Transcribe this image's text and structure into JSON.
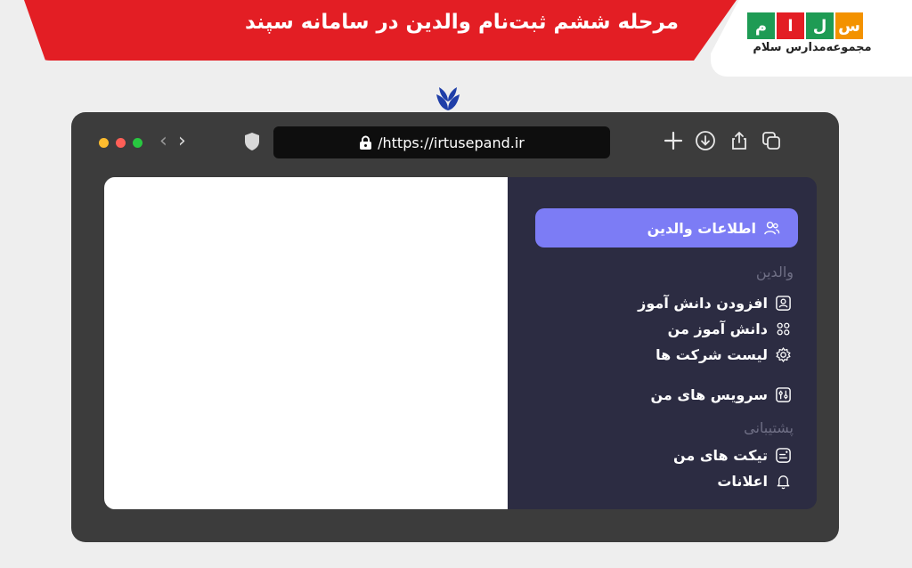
{
  "banner": {
    "title": "مرحله ششم ثبت‌نام والدین در سامانه سپند"
  },
  "logo": {
    "letters": [
      "م",
      "ا",
      "ل",
      "س"
    ],
    "subtitle": "مجموعه‌مدارس سلام"
  },
  "browser": {
    "url": "/https://irtusepand.ir"
  },
  "sidebar": {
    "active_item": {
      "label": "اطلاعات والدین",
      "icon": "users-icon"
    },
    "sections": [
      {
        "label": "والدین"
      },
      {
        "label": "پشتیبانی"
      }
    ],
    "items": [
      {
        "label": "افزودن دانش آموز",
        "icon": "user-badge-icon"
      },
      {
        "label": "دانش آموز من",
        "icon": "group-icon"
      },
      {
        "label": "لیست شرکت ها",
        "icon": "gear-icon"
      },
      {
        "label": "سرویس های من",
        "icon": "sliders-icon"
      },
      {
        "label": "تیکت های من",
        "icon": "ticket-icon"
      },
      {
        "label": "اعلانات",
        "icon": "bell-icon"
      }
    ]
  },
  "colors": {
    "banner_red": "#e31e24",
    "sidebar_bg": "#2c2c42",
    "active_purple": "#7c7cf5",
    "browser_frame": "#3c3c3c"
  }
}
